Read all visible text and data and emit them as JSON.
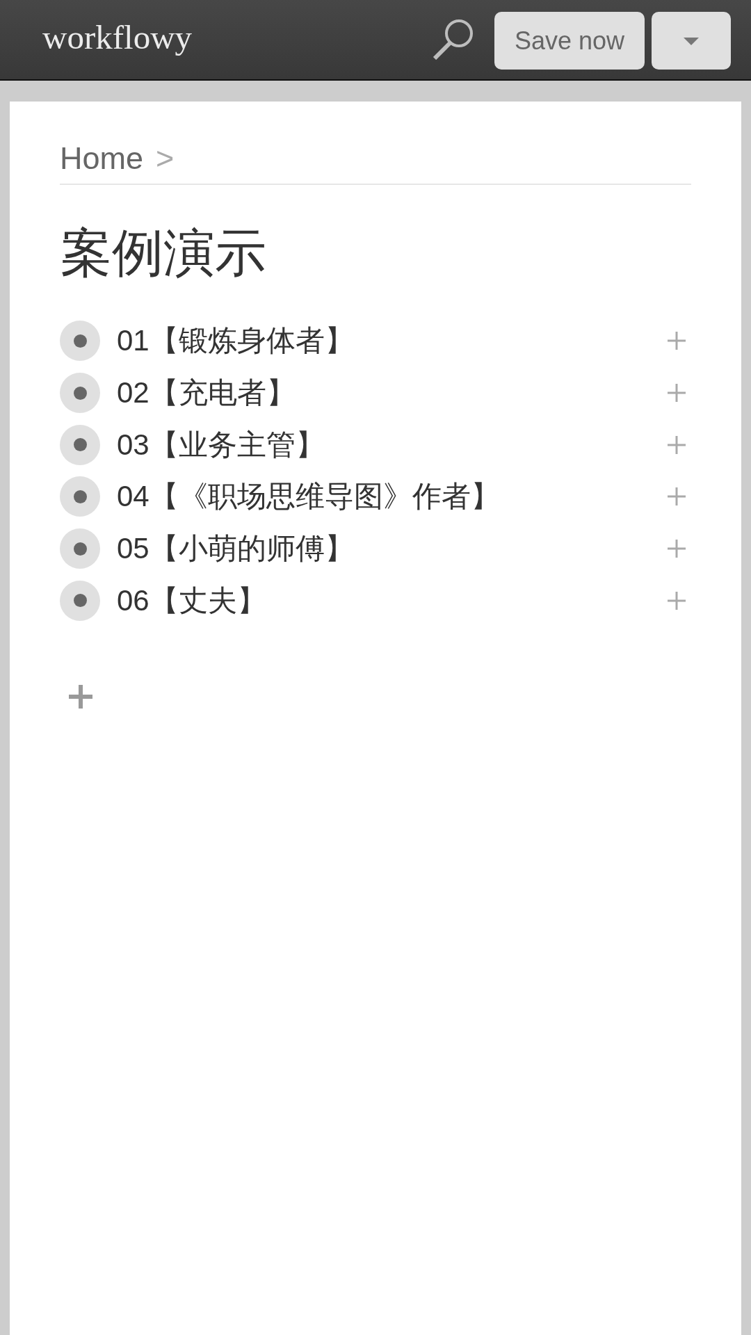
{
  "header": {
    "logo": "workflowy",
    "save_button": "Save now"
  },
  "breadcrumb": {
    "home": "Home",
    "separator": ">"
  },
  "title": "案例演示",
  "items": [
    {
      "text": "01【锻炼身体者】",
      "collapsed": true
    },
    {
      "text": "02【充电者】",
      "collapsed": true
    },
    {
      "text": "03【业务主管】",
      "collapsed": true
    },
    {
      "text": "04【《职场思维导图》作者】",
      "collapsed": true
    },
    {
      "text": "05【小萌的师傅】",
      "collapsed": true
    },
    {
      "text": "06【丈夫】",
      "collapsed": true
    }
  ]
}
